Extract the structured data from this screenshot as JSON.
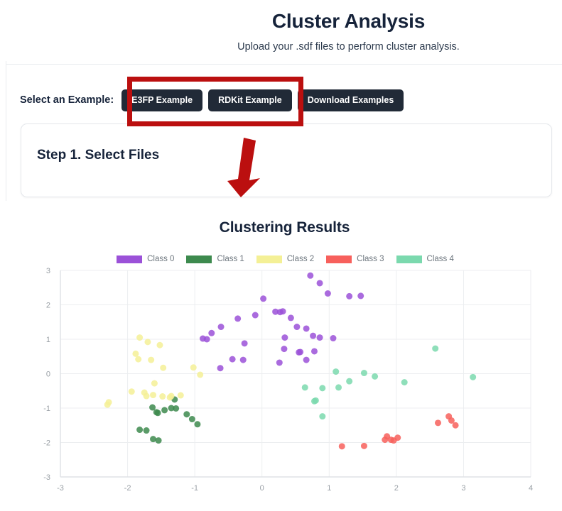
{
  "header": {
    "title": "Cluster Analysis",
    "subtitle": "Upload your .sdf files to perform cluster analysis."
  },
  "example_selector": {
    "label": "Select an Example:",
    "buttons": [
      {
        "label": "E3FP Example",
        "highlighted": true
      },
      {
        "label": "RDKit Example",
        "highlighted": true
      },
      {
        "label": "Download Examples",
        "highlighted": false
      }
    ]
  },
  "step_card": {
    "title": "Step 1. Select Files"
  },
  "annotations": {
    "highlight_box_color": "#bb0f0f",
    "arrow_color": "#bb0f0f",
    "arrow_name": "red-down-arrow"
  },
  "chart_data": {
    "type": "scatter",
    "title": "Clustering Results",
    "xlabel": "",
    "ylabel": "",
    "xlim": [
      -3,
      4
    ],
    "ylim": [
      -3,
      3
    ],
    "xticks": [
      "-3",
      "-2",
      "-1",
      "0",
      "1",
      "2",
      "3",
      "4"
    ],
    "yticks": [
      "3",
      "2",
      "1",
      "0",
      "-1",
      "-2",
      "-3"
    ],
    "grid": true,
    "legend_position": "top-center",
    "marker_size": 9,
    "marker_opacity": 0.85,
    "series": [
      {
        "name": "Class 0",
        "color": "#9b51d8",
        "points": [
          [
            0.72,
            2.85
          ],
          [
            0.86,
            2.63
          ],
          [
            0.98,
            2.33
          ],
          [
            1.3,
            2.25
          ],
          [
            1.47,
            2.26
          ],
          [
            0.02,
            2.18
          ],
          [
            0.2,
            1.8
          ],
          [
            0.27,
            1.79
          ],
          [
            0.31,
            1.81
          ],
          [
            -0.36,
            1.6
          ],
          [
            -0.1,
            1.7
          ],
          [
            0.43,
            1.62
          ],
          [
            -0.61,
            1.36
          ],
          [
            -0.75,
            1.18
          ],
          [
            0.52,
            1.36
          ],
          [
            0.66,
            1.31
          ],
          [
            -0.88,
            1.02
          ],
          [
            -0.82,
            1.0
          ],
          [
            0.34,
            1.05
          ],
          [
            0.76,
            1.1
          ],
          [
            0.86,
            1.05
          ],
          [
            1.06,
            1.03
          ],
          [
            0.33,
            0.72
          ],
          [
            -0.26,
            0.88
          ],
          [
            0.55,
            0.62
          ],
          [
            0.57,
            0.63
          ],
          [
            0.78,
            0.65
          ],
          [
            0.66,
            0.4
          ],
          [
            -0.44,
            0.42
          ],
          [
            -0.28,
            0.4
          ],
          [
            0.26,
            0.32
          ],
          [
            -0.62,
            0.16
          ]
        ]
      },
      {
        "name": "Class 1",
        "color": "#3d8a4e",
        "points": [
          [
            -1.3,
            -0.75
          ],
          [
            -1.63,
            -0.98
          ],
          [
            -1.57,
            -1.12
          ],
          [
            -1.55,
            -1.14
          ],
          [
            -1.45,
            -1.06
          ],
          [
            -1.35,
            -1.0
          ],
          [
            -1.28,
            -1.01
          ],
          [
            -1.12,
            -1.18
          ],
          [
            -1.04,
            -1.32
          ],
          [
            -0.96,
            -1.47
          ],
          [
            -1.82,
            -1.63
          ],
          [
            -1.72,
            -1.65
          ],
          [
            -1.62,
            -1.9
          ],
          [
            -1.54,
            -1.94
          ]
        ]
      },
      {
        "name": "Class 2",
        "color": "#f4f096",
        "points": [
          [
            -1.82,
            1.05
          ],
          [
            -1.7,
            0.92
          ],
          [
            -1.52,
            0.83
          ],
          [
            -1.88,
            0.58
          ],
          [
            -1.84,
            0.42
          ],
          [
            -1.65,
            0.4
          ],
          [
            -1.47,
            0.17
          ],
          [
            -1.02,
            0.18
          ],
          [
            -0.92,
            -0.03
          ],
          [
            -1.6,
            -0.28
          ],
          [
            -1.94,
            -0.52
          ],
          [
            -1.75,
            -0.55
          ],
          [
            -1.72,
            -0.65
          ],
          [
            -1.62,
            -0.62
          ],
          [
            -1.48,
            -0.66
          ],
          [
            -1.35,
            -0.65
          ],
          [
            -1.37,
            -0.69
          ],
          [
            -1.21,
            -0.63
          ],
          [
            -2.28,
            -0.83
          ],
          [
            -2.3,
            -0.9
          ]
        ]
      },
      {
        "name": "Class 3",
        "color": "#f7605c",
        "points": [
          [
            1.19,
            -2.11
          ],
          [
            1.52,
            -2.1
          ],
          [
            1.83,
            -1.92
          ],
          [
            1.86,
            -1.82
          ],
          [
            1.92,
            -1.92
          ],
          [
            1.96,
            -1.94
          ],
          [
            2.02,
            -1.86
          ],
          [
            2.78,
            -1.24
          ],
          [
            2.82,
            -1.36
          ],
          [
            2.62,
            -1.43
          ],
          [
            2.88,
            -1.5
          ]
        ]
      },
      {
        "name": "Class 4",
        "color": "#7bd9ae",
        "points": [
          [
            2.58,
            0.73
          ],
          [
            3.14,
            -0.1
          ],
          [
            1.1,
            0.06
          ],
          [
            1.52,
            0.02
          ],
          [
            1.68,
            -0.08
          ],
          [
            2.12,
            -0.25
          ],
          [
            0.64,
            -0.4
          ],
          [
            1.3,
            -0.22
          ],
          [
            1.14,
            -0.4
          ],
          [
            0.9,
            -0.42
          ],
          [
            0.78,
            -0.8
          ],
          [
            0.8,
            -0.78
          ],
          [
            0.9,
            -1.24
          ]
        ]
      }
    ]
  }
}
